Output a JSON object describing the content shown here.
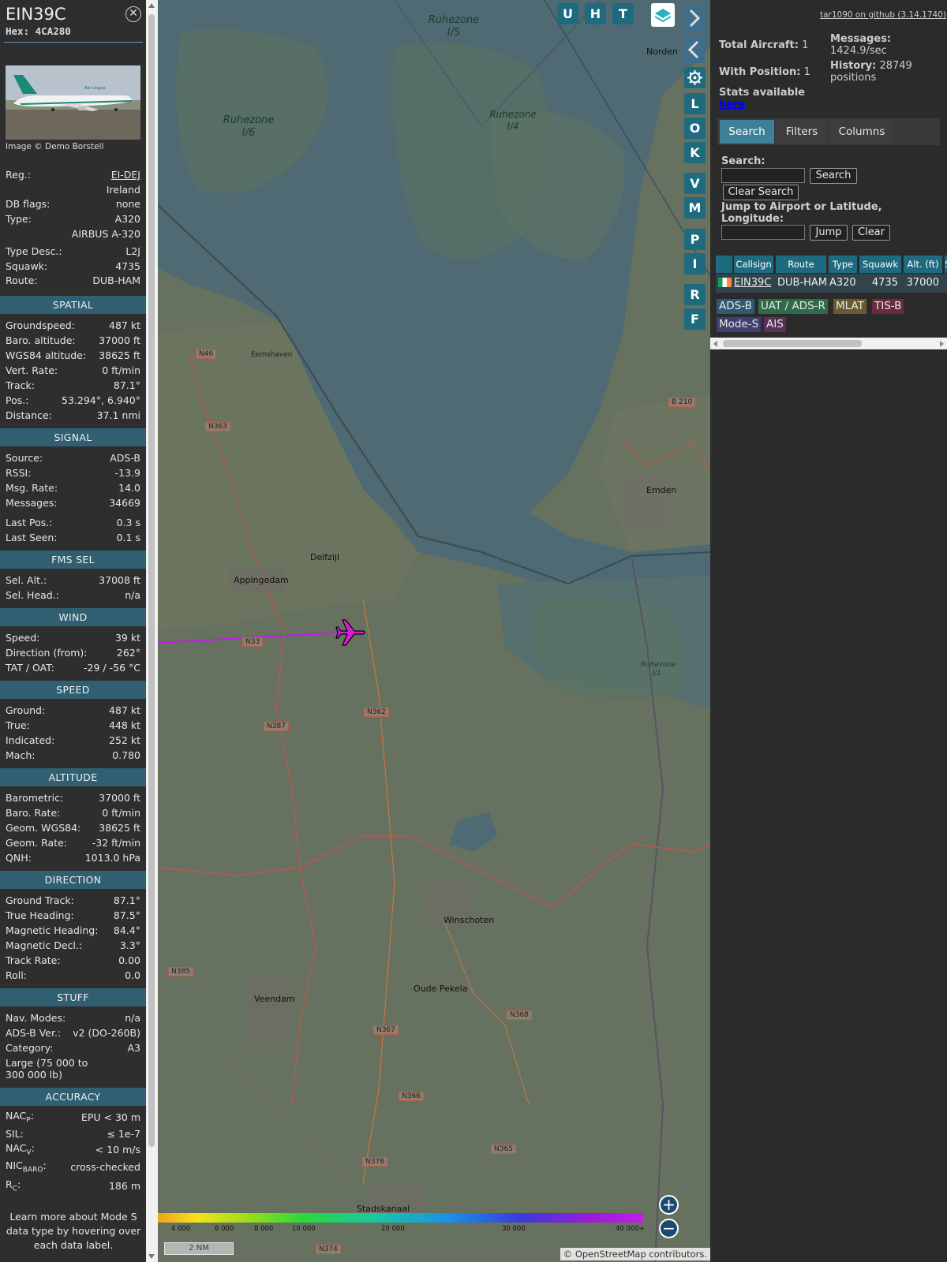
{
  "aircraft": {
    "callsign": "EIN39C",
    "hex": "Hex: 4CA280",
    "photo_caption": "Image © Demo Borstell"
  },
  "info": {
    "reg_label": "Reg.:",
    "reg_value": "EI-DEJ",
    "country": "Ireland",
    "dbflags_label": "DB flags:",
    "dbflags_value": "none",
    "type_label": "Type:",
    "type_value": "A320",
    "type_name": "AIRBUS A-320",
    "typedesc_label": "Type Desc.:",
    "typedesc_value": "L2J",
    "squawk_label": "Squawk:",
    "squawk_value": "4735",
    "route_label": "Route:",
    "route_value": "DUB-HAM"
  },
  "sections": {
    "spatial": {
      "title": "SPATIAL",
      "rows": [
        {
          "label": "Groundspeed:",
          "value": "487 kt"
        },
        {
          "label": "Baro. altitude:",
          "value": "37000 ft"
        },
        {
          "label": "WGS84 altitude:",
          "value": "38625 ft"
        },
        {
          "label": "Vert. Rate:",
          "value": "0 ft/min"
        },
        {
          "label": "Track:",
          "value": "87.1°"
        },
        {
          "label": "Pos.:",
          "value": "53.294°, 6.940°"
        },
        {
          "label": "Distance:",
          "value": "37.1 nmi"
        }
      ]
    },
    "signal": {
      "title": "SIGNAL",
      "rows": [
        {
          "label": "Source:",
          "value": "ADS-B"
        },
        {
          "label": "RSSI:",
          "value": "-13.9"
        },
        {
          "label": "Msg. Rate:",
          "value": "14.0"
        },
        {
          "label": "Messages:",
          "value": "34669"
        },
        {
          "label": "Last Pos.:",
          "value": "0.3 s"
        },
        {
          "label": "Last Seen:",
          "value": "0.1 s"
        }
      ]
    },
    "fms": {
      "title": "FMS SEL",
      "rows": [
        {
          "label": "Sel. Alt.:",
          "value": "37008 ft"
        },
        {
          "label": "Sel. Head.:",
          "value": "n/a"
        }
      ]
    },
    "wind": {
      "title": "WIND",
      "rows": [
        {
          "label": "Speed:",
          "value": "39 kt"
        },
        {
          "label": "Direction (from):",
          "value": "262°"
        },
        {
          "label": "TAT / OAT:",
          "value": "-29 / -56 °C"
        }
      ]
    },
    "speed": {
      "title": "SPEED",
      "rows": [
        {
          "label": "Ground:",
          "value": "487 kt"
        },
        {
          "label": "True:",
          "value": "448 kt"
        },
        {
          "label": "Indicated:",
          "value": "252 kt"
        },
        {
          "label": "Mach:",
          "value": "0.780"
        }
      ]
    },
    "altitude": {
      "title": "ALTITUDE",
      "rows": [
        {
          "label": "Barometric:",
          "value": "37000 ft"
        },
        {
          "label": "Baro. Rate:",
          "value": "0 ft/min"
        },
        {
          "label": "Geom. WGS84:",
          "value": "38625 ft"
        },
        {
          "label": "Geom. Rate:",
          "value": "-32 ft/min"
        },
        {
          "label": "QNH:",
          "value": "1013.0 hPa"
        }
      ]
    },
    "direction": {
      "title": "DIRECTION",
      "rows": [
        {
          "label": "Ground Track:",
          "value": "87.1°"
        },
        {
          "label": "True Heading:",
          "value": "87.5°"
        },
        {
          "label": "Magnetic Heading:",
          "value": "84.4°"
        },
        {
          "label": "Magnetic Decl.:",
          "value": "3.3°"
        },
        {
          "label": "Track Rate:",
          "value": "0.00"
        },
        {
          "label": "Roll:",
          "value": "0.0"
        }
      ]
    },
    "stuff": {
      "title": "STUFF",
      "rows": [
        {
          "label": "Nav. Modes:",
          "value": "n/a"
        },
        {
          "label": "ADS-B Ver.:",
          "value": "v2 (DO-260B)"
        },
        {
          "label": "Category:",
          "value": "A3"
        }
      ],
      "category_desc": "Large (75 000 to 300 000 lb)"
    },
    "accuracy": {
      "title": "ACCURACY",
      "nacp_main": "NAC",
      "nacp_sub": "P",
      "nacp_value": "EPU < 30 m",
      "sil_label": "SIL:",
      "sil_value": "≤ 1e-7",
      "nacv_main": "NAC",
      "nacv_sub": "V",
      "nacv_value": "< 10 m/s",
      "nicbaro_main": "NIC",
      "nicbaro_sub": "BARO",
      "nicbaro_value": "cross-checked",
      "rc_main": "R",
      "rc_sub": "C",
      "rc_value": "186 m"
    },
    "footer": "Learn more about Mode S data type by hovering over each data label."
  },
  "map": {
    "top_buttons": [
      "U",
      "H",
      "T"
    ],
    "side_buttons": [
      "L",
      "O",
      "K",
      "V",
      "M",
      "P",
      "I",
      "R",
      "F"
    ],
    "places": {
      "delfzijl": "Delfzijl",
      "appingedam": "Appingedam",
      "emden": "Emden",
      "norden": "Norden",
      "winschoten": "Winschoten",
      "oude_pekela": "Oude Pekela",
      "veendam": "Veendam",
      "stadskanaal": "Stadskanaal",
      "eemshaven": "Eemshaven"
    },
    "zones": {
      "z15": "Ruhezone I/5",
      "z16": "Ruhezone I/6",
      "z14": "Ruhezone I/4",
      "z11": "Ruhezone I/1"
    },
    "roads": [
      "N46",
      "N363",
      "N33",
      "N362",
      "N387",
      "N385",
      "N367",
      "N368",
      "N366",
      "N365",
      "N378",
      "N374",
      "B 210"
    ],
    "altitude_scale": [
      "4 000",
      "6 000",
      "8 000",
      "10 000",
      "20 000",
      "30 000",
      "40 000+"
    ],
    "distance_scale": "2 NM",
    "attribution_prefix": "© ",
    "attribution_link": "OpenStreetMap",
    "attribution_suffix": " contributors."
  },
  "sidebar": {
    "github_link": "tar1090 on github (3.14.1740)",
    "total_label": "Total Aircraft:",
    "total_value": "1",
    "withpos_label": "With Position:",
    "withpos_value": "1",
    "messages_label": "Messages:",
    "messages_value": "1424.9/sec",
    "history_label": "History:",
    "history_value": "28749 positions",
    "stats_text": "Stats available",
    "stats_link": "here",
    "tabs": [
      "Search",
      "Filters",
      "Columns"
    ],
    "search_label": "Search:",
    "search_button": "Search",
    "clear_search_button": "Clear Search",
    "jump_label": "Jump to Airport or Latitude, Longitude:",
    "jump_button": "Jump",
    "clear_button": "Clear",
    "table_headers": [
      "Callsign",
      "Route",
      "Type",
      "Squawk",
      "Alt. (ft)",
      "S"
    ],
    "table_row": {
      "callsign": "EIN39C",
      "route": "DUB-HAM",
      "type": "A320",
      "squawk": "4735",
      "alt": "37000"
    },
    "sources": {
      "adsb": "ADS-B",
      "uat": "UAT / ADS-R",
      "mlat": "MLAT",
      "tisb": "TIS-B",
      "modes": "Mode-S",
      "ais": "AIS"
    }
  },
  "colors": {
    "section_header": "#2f5f70",
    "accent": "#1e6b80",
    "aircraft": "#d41ed6",
    "track": "#c21ee6"
  }
}
